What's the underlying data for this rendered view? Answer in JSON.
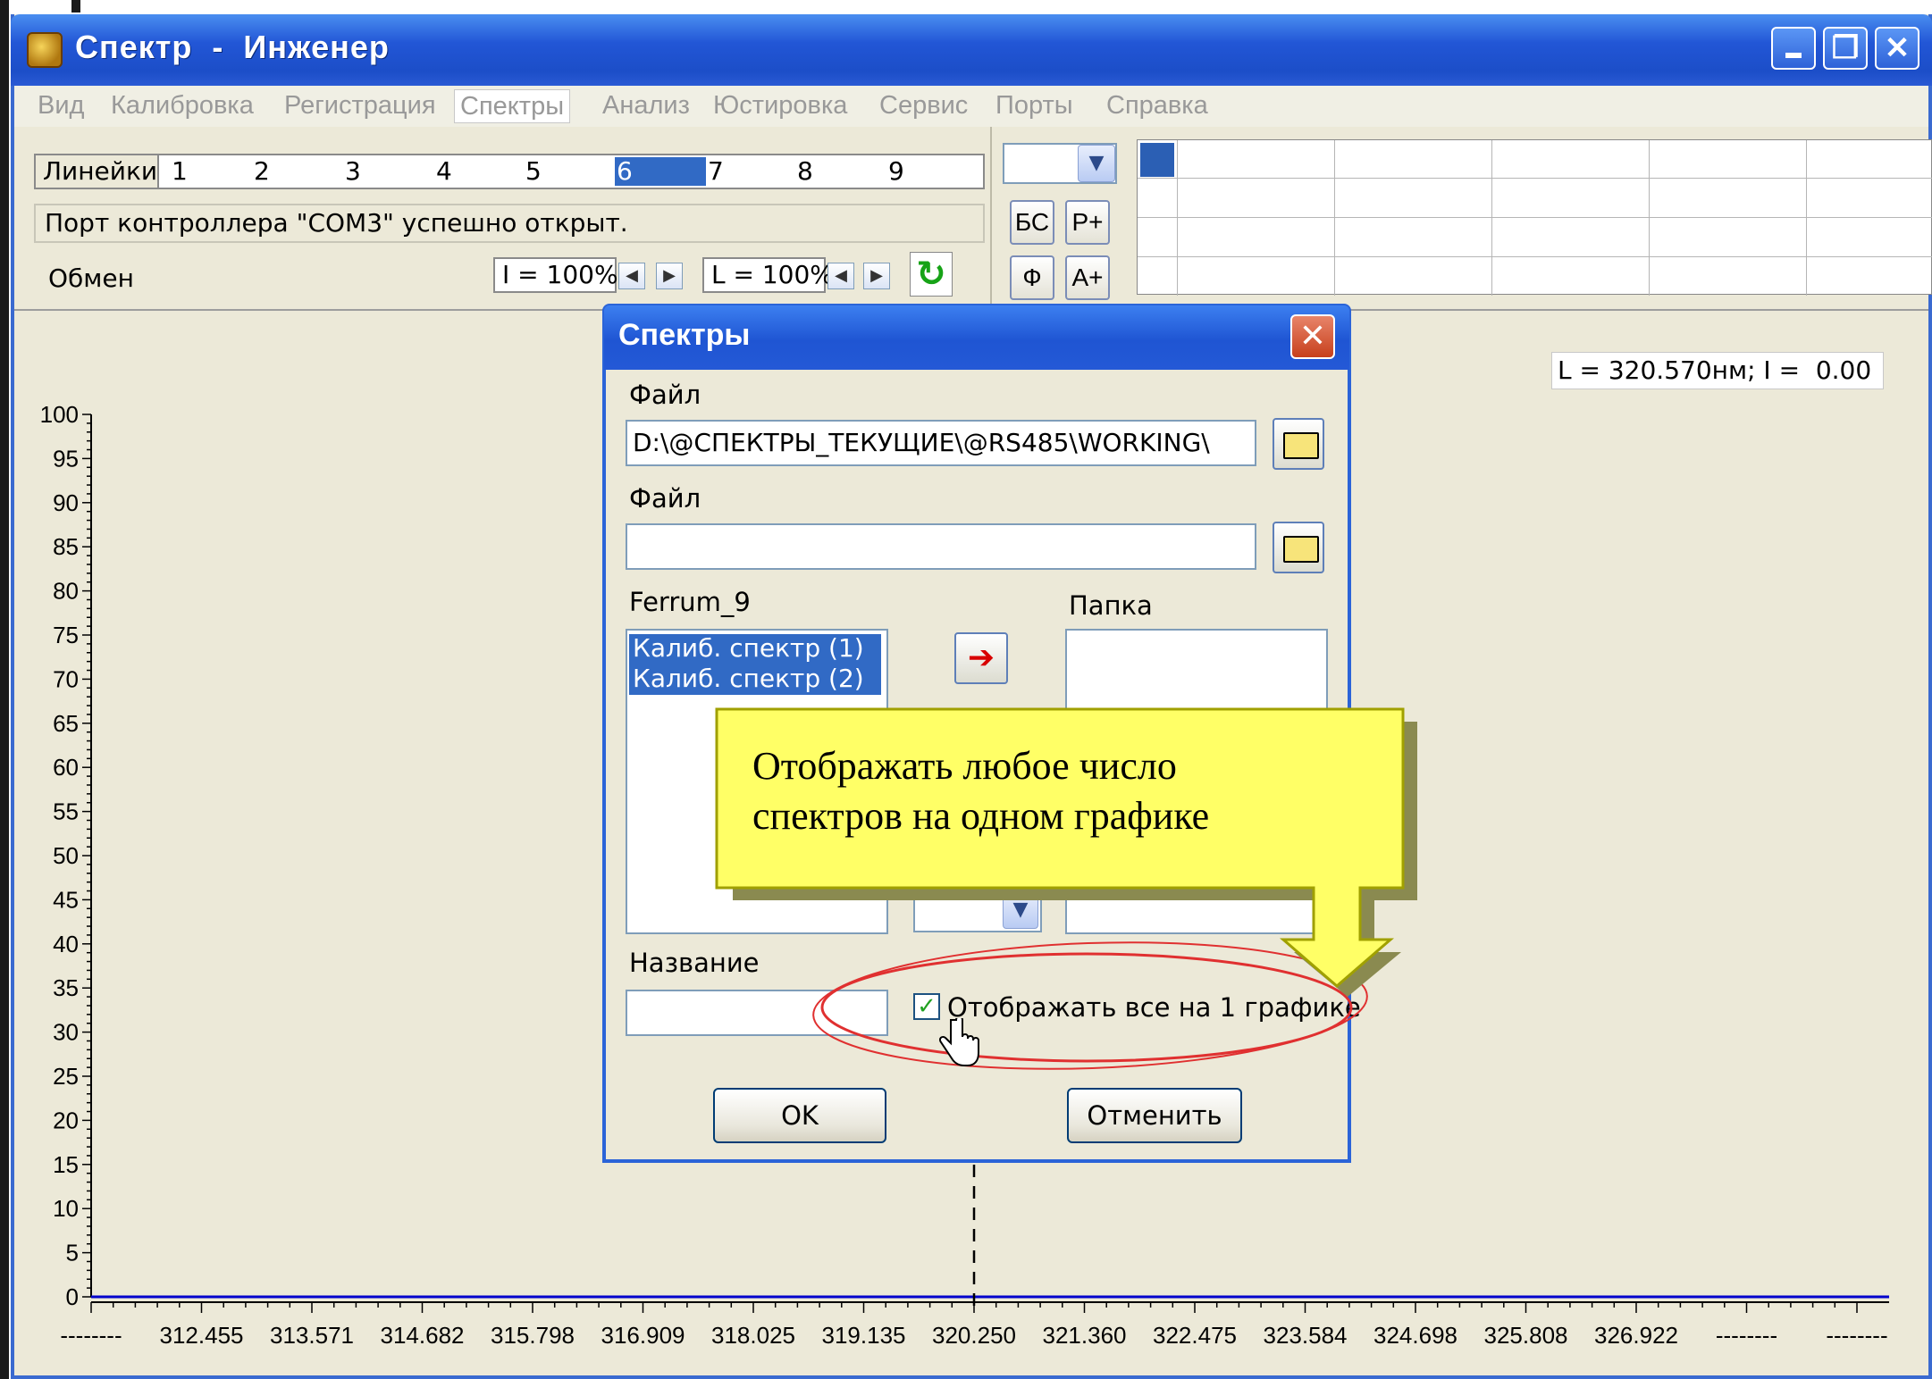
{
  "window": {
    "title": "Спектр  -  Инженер",
    "controls": [
      "minimize",
      "restore",
      "close"
    ]
  },
  "menu": [
    {
      "label": "Вид"
    },
    {
      "label": "Калибровка"
    },
    {
      "label": "Регистрация"
    },
    {
      "label": "Спектры",
      "active": true
    },
    {
      "label": "Анализ"
    },
    {
      "label": "Юстировка"
    },
    {
      "label": "Сервис"
    },
    {
      "label": "Порты"
    },
    {
      "label": "Справка"
    }
  ],
  "toolbar": {
    "lines_label": "Линейки",
    "line_numbers": [
      "1",
      "2",
      "3",
      "4",
      "5",
      "6",
      "7",
      "8",
      "9"
    ],
    "selected_line": "6",
    "status_text": "Порт контроллера \"COM3\" успешно открыт.",
    "exchange_label": "Обмен",
    "intensity_scale": "I = 100%",
    "wavelength_scale": "L = 100%",
    "btn_bs": "БС",
    "btn_rplus": "Р+",
    "btn_f": "Ф",
    "btn_aplus": "А+"
  },
  "plot": {
    "coord_readout": "L = 320.570нм; I =  0.00",
    "y_ticks": [
      "100",
      "95",
      "90",
      "85",
      "80",
      "75",
      "70",
      "65",
      "60",
      "55",
      "50",
      "45",
      "40",
      "35",
      "30",
      "25",
      "20",
      "15",
      "10",
      "5",
      "0"
    ],
    "x_ticks": [
      "--------",
      "312.455",
      "313.571",
      "314.682",
      "315.798",
      "316.909",
      "318.025",
      "319.135",
      "320.250",
      "321.360",
      "322.475",
      "323.584",
      "324.698",
      "325.808",
      "326.922",
      "--------",
      "--------"
    ],
    "cursor_x_label": "320.250",
    "series_color": "#0000cc"
  },
  "dialog": {
    "title": "Спектры",
    "file1_label": "Файл",
    "file1_value": "D:\\@СПЕКТРЫ_ТЕКУЩИЕ\\@RS485\\WORKING\\",
    "file2_label": "Файл",
    "file2_value": "",
    "list_label": "Ferrum_9",
    "list_items": [
      "Калиб. спектр (1)",
      "Калиб. спектр (2)"
    ],
    "folder_label": "Папка",
    "name_label": "Название",
    "name_value": "",
    "checkbox_label": "Отображать все на 1 графике",
    "checkbox_checked": true,
    "ok_label": "OK",
    "cancel_label": "Отменить"
  },
  "callout": {
    "line1": "Отображать любое число",
    "line2": "спектров на одном графике",
    "fill_color": "#ffff66",
    "highlight_color": "#e03030"
  }
}
